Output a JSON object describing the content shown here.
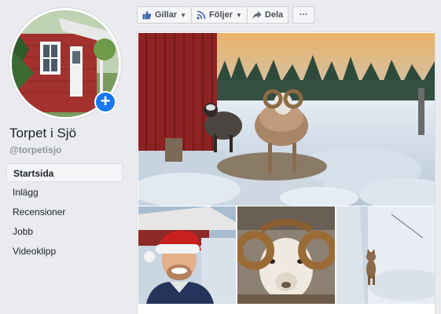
{
  "page": {
    "name": "Torpet i Sjö",
    "handle": "@torpetisjo"
  },
  "nav": {
    "items": [
      {
        "label": "Startsida",
        "active": true
      },
      {
        "label": "Inlägg",
        "active": false
      },
      {
        "label": "Recensioner",
        "active": false
      },
      {
        "label": "Jobb",
        "active": false
      },
      {
        "label": "Videoklipp",
        "active": false
      }
    ]
  },
  "actions": {
    "like_label": "Gillar",
    "follow_label": "Följer",
    "share_label": "Dela",
    "more_label": "···"
  },
  "icons": {
    "like": "thumbs-up-icon",
    "follow": "rss-icon",
    "share": "share-arrow-icon",
    "add": "plus-icon"
  },
  "colors": {
    "accent": "#1877f2",
    "background": "#e9ebee",
    "barn_red": "#a52a2a"
  }
}
